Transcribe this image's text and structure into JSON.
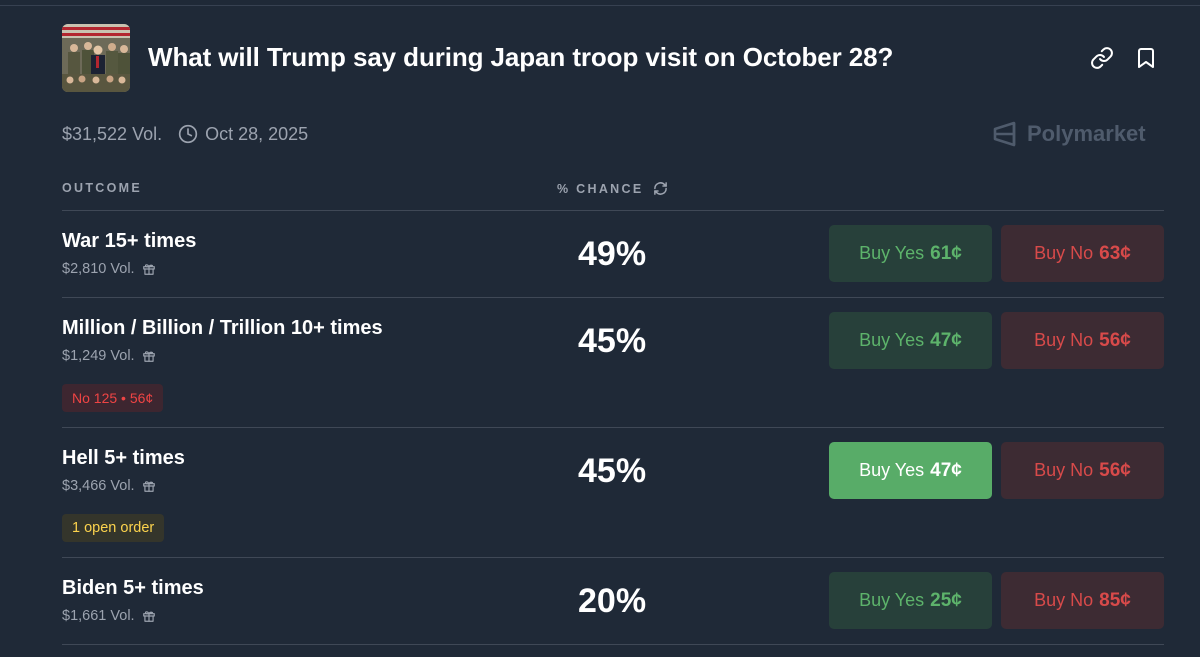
{
  "market": {
    "title": "What will Trump say during Japan troop visit on October 28?",
    "volume": "$31,522 Vol.",
    "date": "Oct 28, 2025",
    "brand": "Polymarket"
  },
  "header_icons": {
    "link": "link-icon",
    "bookmark": "bookmark-icon",
    "clock": "clock-icon",
    "refresh": "refresh-icon",
    "gift": "gift-icon",
    "brand_logo": "polymarket-logo"
  },
  "table": {
    "col_outcome": "OUTCOME",
    "col_chance": "% CHANCE"
  },
  "outcomes": [
    {
      "name": "War 15+ times",
      "volume": "$2,810 Vol.",
      "chance": "49%",
      "yes_label": "Buy Yes",
      "yes_price": "61¢",
      "no_label": "Buy No",
      "no_price": "63¢"
    },
    {
      "name": "Million / Billion / Trillion 10+ times",
      "volume": "$1,249 Vol.",
      "chance": "45%",
      "yes_label": "Buy Yes",
      "yes_price": "47¢",
      "no_label": "Buy No",
      "no_price": "56¢",
      "position_badge": "No 125 • 56¢"
    },
    {
      "name": "Hell 5+ times",
      "volume": "$3,466 Vol.",
      "chance": "45%",
      "yes_label": "Buy Yes",
      "yes_price": "47¢",
      "no_label": "Buy No",
      "no_price": "56¢",
      "order_badge": "1 open order",
      "yes_active": true
    },
    {
      "name": "Biden 5+ times",
      "volume": "$1,661 Vol.",
      "chance": "20%",
      "yes_label": "Buy Yes",
      "yes_price": "25¢",
      "no_label": "Buy No",
      "no_price": "85¢"
    }
  ],
  "colors": {
    "background": "#1f2937",
    "yes_text": "#5db36b",
    "yes_bg": "#27403a",
    "yes_active_bg": "#58ac68",
    "no_text": "#d84a4a",
    "no_bg": "#3d2b33",
    "badge_no_text": "#ef4444",
    "badge_order_text": "#fcd34d"
  }
}
